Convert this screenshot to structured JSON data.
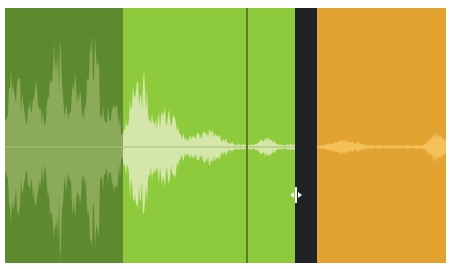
{
  "timeline": {
    "clips": [
      {
        "id": "clip-1",
        "state": "unselected",
        "color": "#5e8a2f",
        "wave_color": "#9bb56a"
      },
      {
        "id": "clip-2",
        "state": "selected",
        "color": "#8ecb3c",
        "wave_color": "#dbe9b5"
      },
      {
        "id": "clip-3",
        "state": "unselected",
        "color": "#e3a331",
        "wave_color": "#f4c45c"
      }
    ],
    "gap_color": "#1f2326",
    "playhead_color": "#5f7a2c",
    "trim_cursor": "trim-cursor-icon"
  }
}
